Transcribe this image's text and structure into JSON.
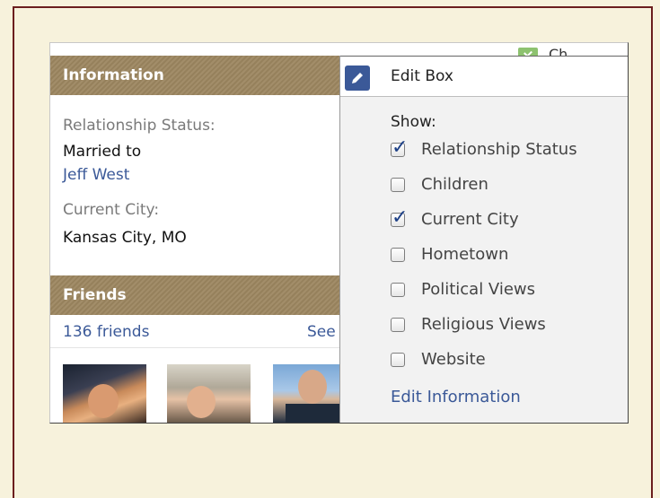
{
  "clipped_top_text": "Ch",
  "info_panel": {
    "title": "Information",
    "relationship_label": "Relationship Status:",
    "relationship_value": "Married to",
    "spouse_link": "Jeff West",
    "city_label": "Current City:",
    "city_value": "Kansas City, MO"
  },
  "friends_panel": {
    "title": "Friends",
    "count_link": "136 friends",
    "see_all": "See All"
  },
  "edit_box": {
    "title": "Edit Box",
    "show_label": "Show:",
    "options": [
      {
        "label": "Relationship Status",
        "checked": true
      },
      {
        "label": "Children",
        "checked": false
      },
      {
        "label": "Current City",
        "checked": true
      },
      {
        "label": "Hometown",
        "checked": false
      },
      {
        "label": "Political Views",
        "checked": false
      },
      {
        "label": "Religious Views",
        "checked": false
      },
      {
        "label": "Website",
        "checked": false
      }
    ],
    "edit_info_link": "Edit Information"
  },
  "colors": {
    "header_bg": "#9c8660",
    "link": "#3b5998",
    "background": "#f7f2dc",
    "frame": "#6b1e1e"
  }
}
